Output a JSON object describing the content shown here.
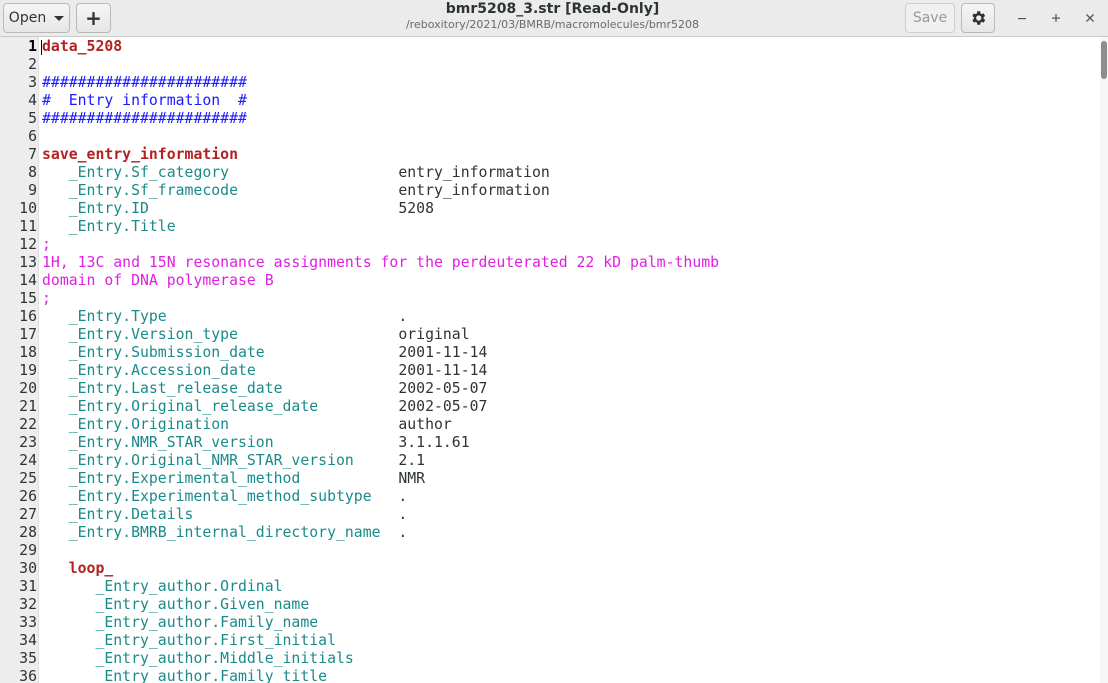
{
  "window": {
    "title": "bmr5208_3.str [Read-Only]",
    "subtitle": "/reboxitory/2021/03/BMRB/macromolecules/bmr5208"
  },
  "toolbar": {
    "open_label": "Open",
    "new_label": "+",
    "save_label": "Save",
    "settings_icon": "gear-icon",
    "window_controls": [
      "minimize-icon",
      "maximize-icon",
      "close-icon"
    ]
  },
  "editor": {
    "current_line": 1,
    "lines": [
      {
        "n": "1",
        "segs": [
          {
            "t": "data_5208",
            "c": "k"
          }
        ]
      },
      {
        "n": "2",
        "segs": []
      },
      {
        "n": "3",
        "segs": [
          {
            "t": "#######################",
            "c": "cmt"
          }
        ]
      },
      {
        "n": "4",
        "segs": [
          {
            "t": "#  Entry information  #",
            "c": "cmt"
          }
        ]
      },
      {
        "n": "5",
        "segs": [
          {
            "t": "#######################",
            "c": "cmt"
          }
        ]
      },
      {
        "n": "6",
        "segs": []
      },
      {
        "n": "7",
        "segs": [
          {
            "t": "save_entry_information",
            "c": "k"
          }
        ]
      },
      {
        "n": "8",
        "segs": [
          {
            "t": "   _Entry.Sf_category                   ",
            "c": "tag"
          },
          {
            "t": "entry_information",
            "c": "val"
          }
        ]
      },
      {
        "n": "9",
        "segs": [
          {
            "t": "   _Entry.Sf_framecode                  ",
            "c": "tag"
          },
          {
            "t": "entry_information",
            "c": "val"
          }
        ]
      },
      {
        "n": "10",
        "segs": [
          {
            "t": "   _Entry.ID                            ",
            "c": "tag"
          },
          {
            "t": "5208",
            "c": "val"
          }
        ]
      },
      {
        "n": "11",
        "segs": [
          {
            "t": "   _Entry.Title",
            "c": "tag"
          }
        ]
      },
      {
        "n": "12",
        "segs": [
          {
            "t": ";",
            "c": "str"
          }
        ]
      },
      {
        "n": "13",
        "segs": [
          {
            "t": "1H, 13C and 15N resonance assignments for the perdeuterated 22 kD palm-thumb",
            "c": "str"
          }
        ]
      },
      {
        "n": "14",
        "segs": [
          {
            "t": "domain of DNA polymerase B",
            "c": "str"
          }
        ]
      },
      {
        "n": "15",
        "segs": [
          {
            "t": ";",
            "c": "str"
          }
        ]
      },
      {
        "n": "16",
        "segs": [
          {
            "t": "   _Entry.Type                          ",
            "c": "tag"
          },
          {
            "t": ".",
            "c": "val"
          }
        ]
      },
      {
        "n": "17",
        "segs": [
          {
            "t": "   _Entry.Version_type                  ",
            "c": "tag"
          },
          {
            "t": "original",
            "c": "val"
          }
        ]
      },
      {
        "n": "18",
        "segs": [
          {
            "t": "   _Entry.Submission_date               ",
            "c": "tag"
          },
          {
            "t": "2001-11-14",
            "c": "val"
          }
        ]
      },
      {
        "n": "19",
        "segs": [
          {
            "t": "   _Entry.Accession_date                ",
            "c": "tag"
          },
          {
            "t": "2001-11-14",
            "c": "val"
          }
        ]
      },
      {
        "n": "20",
        "segs": [
          {
            "t": "   _Entry.Last_release_date             ",
            "c": "tag"
          },
          {
            "t": "2002-05-07",
            "c": "val"
          }
        ]
      },
      {
        "n": "21",
        "segs": [
          {
            "t": "   _Entry.Original_release_date         ",
            "c": "tag"
          },
          {
            "t": "2002-05-07",
            "c": "val"
          }
        ]
      },
      {
        "n": "22",
        "segs": [
          {
            "t": "   _Entry.Origination                   ",
            "c": "tag"
          },
          {
            "t": "author",
            "c": "val"
          }
        ]
      },
      {
        "n": "23",
        "segs": [
          {
            "t": "   _Entry.NMR_STAR_version              ",
            "c": "tag"
          },
          {
            "t": "3.1.1.61",
            "c": "val"
          }
        ]
      },
      {
        "n": "24",
        "segs": [
          {
            "t": "   _Entry.Original_NMR_STAR_version     ",
            "c": "tag"
          },
          {
            "t": "2.1",
            "c": "val"
          }
        ]
      },
      {
        "n": "25",
        "segs": [
          {
            "t": "   _Entry.Experimental_method           ",
            "c": "tag"
          },
          {
            "t": "NMR",
            "c": "val"
          }
        ]
      },
      {
        "n": "26",
        "segs": [
          {
            "t": "   _Entry.Experimental_method_subtype   ",
            "c": "tag"
          },
          {
            "t": ".",
            "c": "val"
          }
        ]
      },
      {
        "n": "27",
        "segs": [
          {
            "t": "   _Entry.Details                       ",
            "c": "tag"
          },
          {
            "t": ".",
            "c": "val"
          }
        ]
      },
      {
        "n": "28",
        "segs": [
          {
            "t": "   _Entry.BMRB_internal_directory_name  ",
            "c": "tag"
          },
          {
            "t": ".",
            "c": "val"
          }
        ]
      },
      {
        "n": "29",
        "segs": []
      },
      {
        "n": "30",
        "segs": [
          {
            "t": "   ",
            "c": "val"
          },
          {
            "t": "loop_",
            "c": "k"
          }
        ]
      },
      {
        "n": "31",
        "segs": [
          {
            "t": "      _Entry_author.Ordinal",
            "c": "tag"
          }
        ]
      },
      {
        "n": "32",
        "segs": [
          {
            "t": "      _Entry_author.Given_name",
            "c": "tag"
          }
        ]
      },
      {
        "n": "33",
        "segs": [
          {
            "t": "      _Entry_author.Family_name",
            "c": "tag"
          }
        ]
      },
      {
        "n": "34",
        "segs": [
          {
            "t": "      _Entry_author.First_initial",
            "c": "tag"
          }
        ]
      },
      {
        "n": "35",
        "segs": [
          {
            "t": "      _Entry_author.Middle_initials",
            "c": "tag"
          }
        ]
      },
      {
        "n": "36",
        "segs": [
          {
            "t": "      _Entry_author.Family_title",
            "c": "tag"
          }
        ]
      }
    ]
  }
}
